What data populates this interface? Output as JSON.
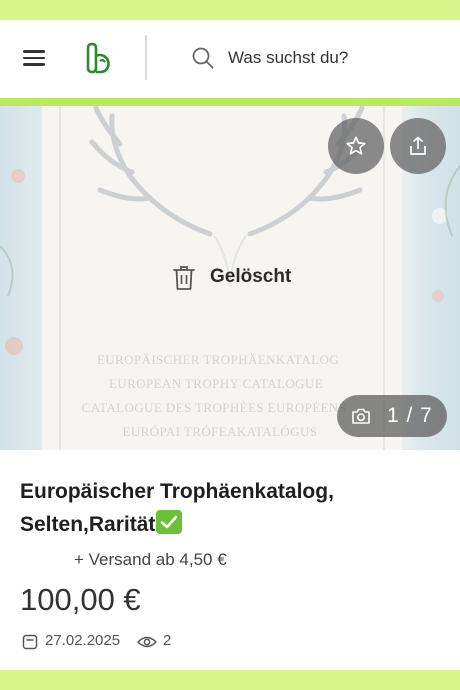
{
  "header": {
    "search_placeholder": "Was suchst du?",
    "menu_icon": "hamburger-menu-icon",
    "logo_icon": "brand-logo-icon",
    "search_icon": "search-icon"
  },
  "gallery": {
    "status_label": "Gelöscht",
    "counter": "1 / 7",
    "favorite_icon": "star-icon",
    "share_icon": "share-icon",
    "camera_icon": "camera-icon",
    "trash_icon": "trash-icon",
    "cover_text": [
      "EUROPÄISCHER TROPHÄENKATALOG",
      "EUROPEAN TROPHY CATALOGUE",
      "CATALOGUE DES TROPHÈES EUROPÉENS",
      "EURÓPAI TRÓFEAKATALÓGUS"
    ]
  },
  "listing": {
    "title": "Europäischer Trophäenkatalog, Selten,Rarität",
    "title_emoji": "check-mark-button-icon",
    "shipping": "+ Versand ab 4,50 €",
    "price": "100,00 €",
    "date": "27.02.2025",
    "views": "2",
    "calendar_icon": "calendar-icon",
    "views_icon": "eye-icon"
  },
  "colors": {
    "accent_light": "#d7f58a",
    "accent": "#b8ea5a",
    "brand_green": "#2e8a2e",
    "overlay_button": "#5f5f5f"
  }
}
